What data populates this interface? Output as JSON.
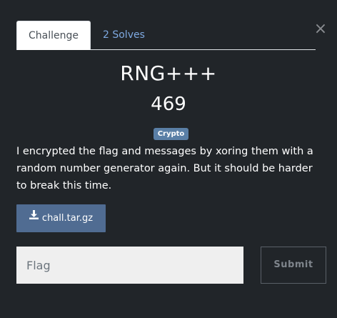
{
  "modal": {
    "close_glyph": "×"
  },
  "tabs": {
    "challenge_label": "Challenge",
    "solves_label": "2 Solves"
  },
  "challenge": {
    "name": "RNG+++",
    "points": "469",
    "category": "Crypto",
    "description": "I encrypted the flag and messages by xoring them with a random number generator again. But it should be harder to break this time.",
    "file_name": "chall.tar.gz"
  },
  "form": {
    "flag_placeholder": "Flag",
    "submit_label": "Submit"
  },
  "colors": {
    "background": "#212529",
    "badge": "#5a7fa6",
    "file_button": "#506c92",
    "tab_link": "#7ea9e1"
  },
  "icons": {
    "close": "close-icon",
    "download": "download-icon"
  }
}
